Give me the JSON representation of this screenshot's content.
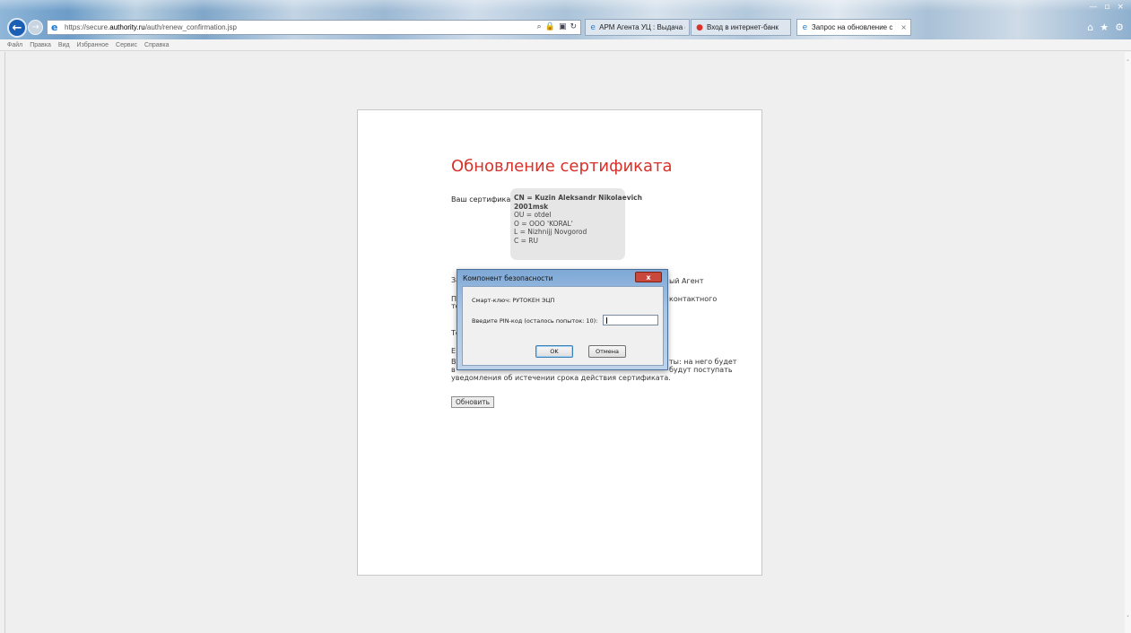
{
  "browser": {
    "url_prefix": "https://secure.",
    "url_domain": "authority.ru",
    "url_path": "/auth/renew_confirmation.jsp",
    "tabs": [
      {
        "label": "АРМ Агента УЦ : Выдача серт...",
        "active": false
      },
      {
        "label": "Вход в интернет-банк",
        "active": false
      },
      {
        "label": "Запрос на обновление се...",
        "active": true
      }
    ],
    "tab_close": "×",
    "menu": [
      "Файл",
      "Правка",
      "Вид",
      "Избранное",
      "Сервис",
      "Справка"
    ]
  },
  "page": {
    "title": "Обновление сертификата",
    "cert_label": "Ваш сертификат",
    "cert_lines": [
      "CN = Kuzin Aleksandr Nikolaevich",
      "2001msk",
      "OU = otdel",
      "O = ООО 'KORAL'",
      "L = Nizhnijj Novgorod",
      "C = RU"
    ],
    "fragments": {
      "line1_left": "За",
      "line1_right": "ый Агент",
      "line2_left": "По",
      "line2_right": "контактного",
      "line3_left": "те",
      "line4_left": "Те",
      "line5_left": "Е",
      "line6_left": "В",
      "line6_right": "ты: на него будет",
      "line7_left": "в",
      "line7_right": "будут поступать",
      "line8": "уведомления об истечении срока действия сертификата."
    },
    "renew_button": "Обновить"
  },
  "dialog": {
    "title": "Компонент безопасности",
    "close_label": "x",
    "smartcard_text": "Смарт-ключ: РУТОКЕН ЭЦП",
    "pin_label": "Введите PIN-код (осталось попыток: 10):",
    "ok_label": "OK",
    "cancel_label": "Отмена"
  }
}
